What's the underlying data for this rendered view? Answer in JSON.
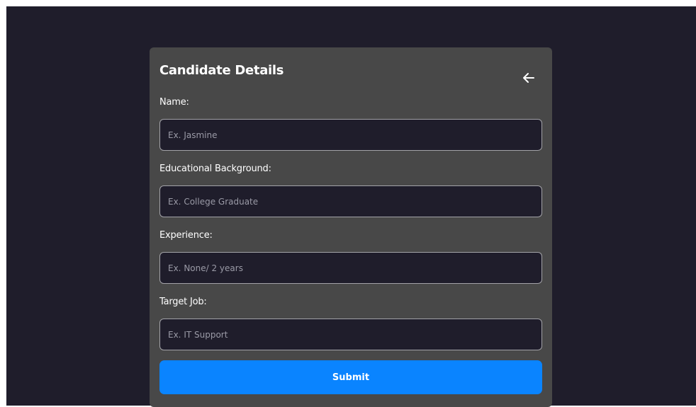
{
  "form": {
    "title": "Candidate Details",
    "back_icon": "arrow-left-icon",
    "fields": [
      {
        "label": "Name:",
        "placeholder": "Ex. Jasmine",
        "value": ""
      },
      {
        "label": "Educational Background:",
        "placeholder": "Ex. College Graduate",
        "value": ""
      },
      {
        "label": "Experience:",
        "placeholder": "Ex. None/ 2 years",
        "value": ""
      },
      {
        "label": "Target Job:",
        "placeholder": "Ex. IT Support",
        "value": ""
      }
    ],
    "submit_label": "Submit"
  },
  "colors": {
    "page_background": "#1f1d2b",
    "card_background": "#484848",
    "input_background": "#1f1d2b",
    "accent": "#0a84ff",
    "text": "#ffffff",
    "placeholder": "#9a9aa6"
  }
}
